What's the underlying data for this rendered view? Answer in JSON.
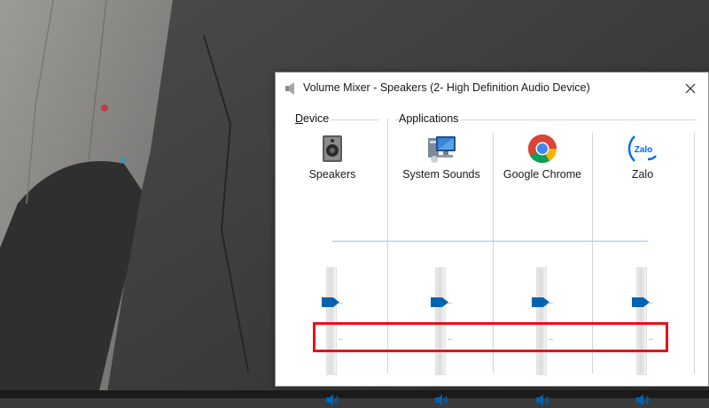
{
  "window": {
    "title": "Volume Mixer - Speakers (2- High Definition Audio Device)"
  },
  "groups": {
    "device_label": "Device",
    "device_accesskey": "D",
    "applications_label": "Applications"
  },
  "channels": [
    {
      "label": "Speakers",
      "icon": "speaker-device-icon",
      "volume_percent": 68
    },
    {
      "label": "System Sounds",
      "icon": "system-sounds-icon",
      "volume_percent": 68
    },
    {
      "label": "Google Chrome",
      "icon": "google-chrome-icon",
      "volume_percent": 68
    },
    {
      "label": "Zalo",
      "icon": "zalo-icon",
      "icon_text": "Zalo",
      "volume_percent": 68
    }
  ],
  "colors": {
    "highlight": "#e3131b",
    "accent": "#0063b1"
  }
}
